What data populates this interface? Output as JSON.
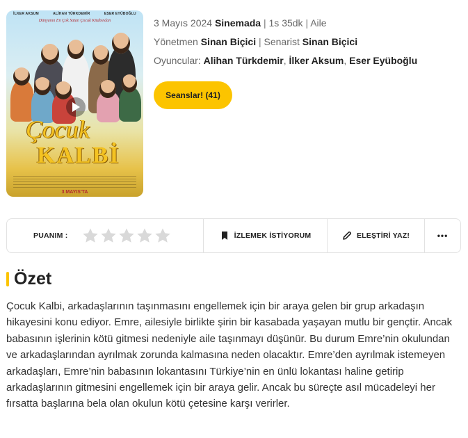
{
  "poster": {
    "cast": [
      "İLKER AKSUM",
      "ALİHAN TÜRKDEMİR",
      "ESER EYÜBOĞLU"
    ],
    "tagline": "Dünyanın En Çok Satan Çocuk Kitabından",
    "title_line1": "Çocuk",
    "title_line2": "KALBİ",
    "release": "3 MAYIS'TA"
  },
  "meta": {
    "date": "3 Mayıs 2024",
    "place": "Sinemada",
    "duration": "1s 35dk",
    "genre": "Aile",
    "director_label": "Yönetmen",
    "director": "Sinan Biçici",
    "writer_label": "Senarist",
    "writer": "Sinan Biçici",
    "cast_label": "Oyuncular:",
    "cast": [
      "Alihan Türkdemir",
      "İlker Aksum",
      "Eser Eyüboğlu"
    ]
  },
  "seans_button": "Seanslar! (41)",
  "rating_bar": {
    "label": "PUANIM :",
    "stars_filled": 0,
    "stars_total": 5,
    "watch_label": "İZLEMEK İSTİYORUM",
    "review_label": "ELEŞTİRİ YAZ!",
    "more_label": "•••"
  },
  "summary": {
    "heading": "Özet",
    "text": "Çocuk Kalbi, arkadaşlarının taşınmasını engellemek için bir araya gelen bir grup arkadaşın hikayesini konu ediyor. Emre, ailesiyle birlikte şirin bir kasabada yaşayan mutlu bir gençtir. Ancak babasının işlerinin kötü gitmesi nedeniyle aile taşınmayı düşünür. Bu durum Emre’nin okulundan ve arkadaşlarından ayrılmak zorunda kalmasına neden olacaktır. Emre’den ayrılmak istemeyen arkadaşları, Emre’nin babasının lokantasını Türkiye’nin en ünlü lokantası haline getirip arkadaşlarının gitmesini engellemek için bir araya gelir. Ancak bu süreçte asıl mücadeleyi her fırsatta başlarına bela olan okulun kötü çetesine karşı verirler."
  },
  "colors": {
    "accent": "#fcc400",
    "star_empty": "#d9d9d9"
  }
}
